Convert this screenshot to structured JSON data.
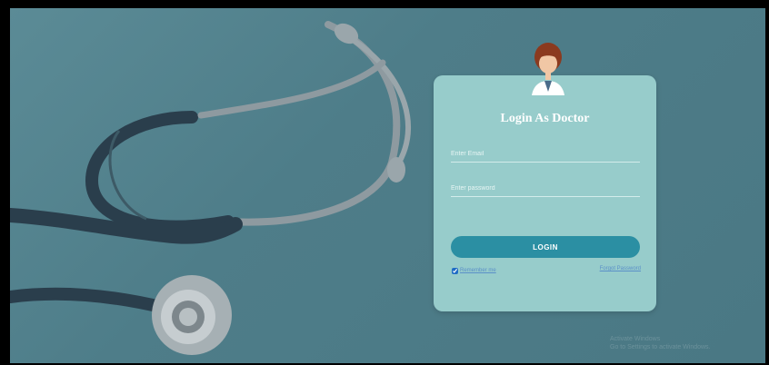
{
  "login_card": {
    "title": "Login As Doctor",
    "email_placeholder": "Enter Email",
    "password_placeholder": "Enter password",
    "login_label": "LOGIN",
    "remember_label": "Remember me",
    "remember_checked": true,
    "forgot_label": "Forgot Password"
  },
  "watermark": {
    "line1": "Activate Windows",
    "line2": "Go to Settings to activate Windows."
  },
  "colors": {
    "background": "#5b8b96",
    "card": "#97cccb",
    "button": "#2b8fa3"
  },
  "icons": {
    "avatar": "doctor-avatar-icon",
    "checkbox": "checkbox-icon"
  }
}
